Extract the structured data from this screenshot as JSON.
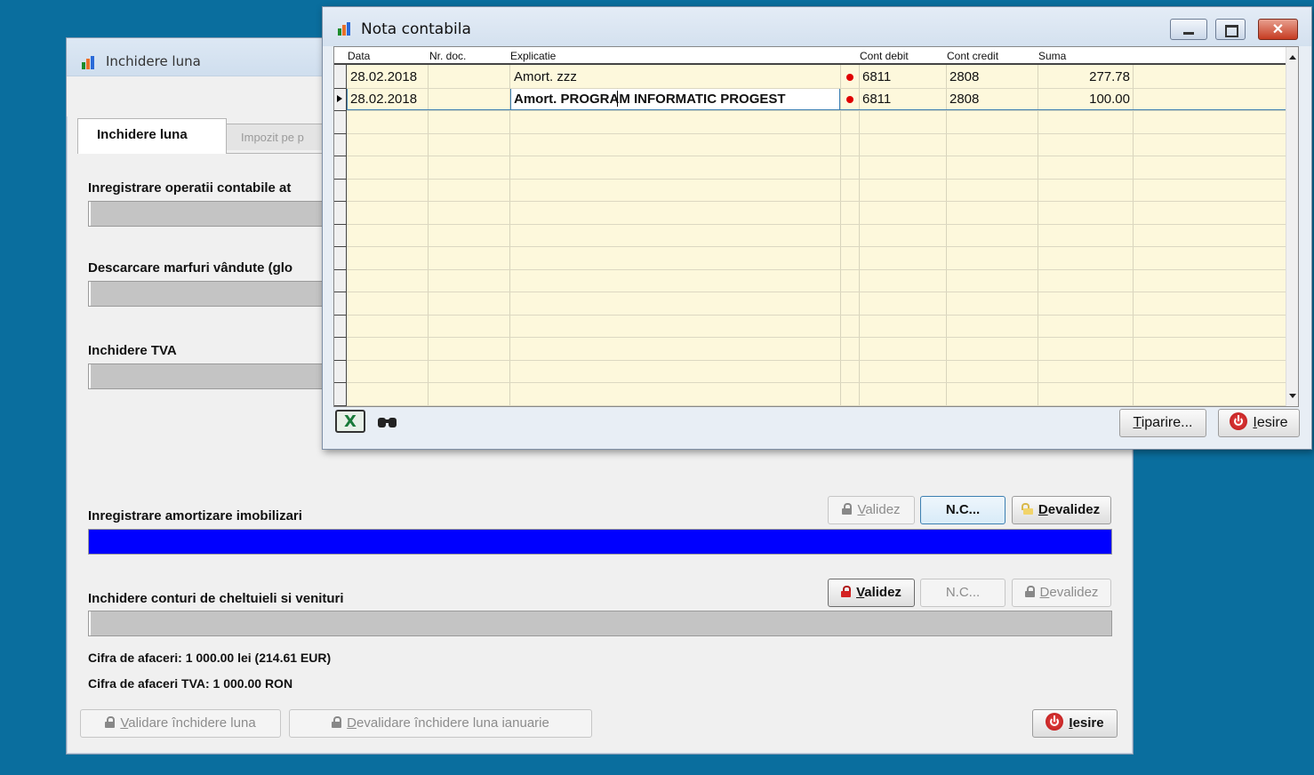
{
  "back_window": {
    "title": "Inchidere luna",
    "tabs": [
      "Inchidere luna",
      "Impozit pe p"
    ],
    "sections": {
      "operatii": "Inregistrare operatii contabile at",
      "descarcare": "Descarcare marfuri vândute (glo",
      "tva": "Inchidere TVA",
      "amortizare": "Inregistrare amortizare imobilizari",
      "cheltuieli": "Inchidere conturi de cheltuieli si venituri"
    },
    "amortizare_progress": 1.0,
    "buttons": {
      "validez_prefix": "V",
      "validez_rest": "alidez",
      "nc": "N.C...",
      "devalidez_prefix": "D",
      "devalidez_rest": "evalidez",
      "validare_prefix": "V",
      "validare_rest": "alidare închidere luna",
      "devalidare_prefix": "D",
      "devalidare_rest": "evalidare închidere luna ianuarie",
      "iesire_prefix": "I",
      "iesire_rest": "esire"
    },
    "cifra_afaceri": "Cifra de afaceri: 1 000.00 lei (214.61 EUR)",
    "cifra_afaceri_tva": "Cifra de afaceri TVA: 1 000.00 RON"
  },
  "front_window": {
    "title": "Nota contabila",
    "columns": [
      "Data",
      "Nr. doc.",
      "Explicatie",
      "Cont debit",
      "Cont credit",
      "Suma"
    ],
    "rows": [
      {
        "data": "28.02.2018",
        "nr_doc": "",
        "explicatie": "Amort. zzz",
        "cont_debit": "6811",
        "cont_credit": "2808",
        "suma": "277.78"
      },
      {
        "data": "28.02.2018",
        "nr_doc": "",
        "explicatie": "Amort. PROGRAM INFORMATIC PROGEST",
        "cont_debit": "6811",
        "cont_credit": "2808",
        "suma": "100.00"
      }
    ],
    "tiparire_prefix": "T",
    "tiparire_rest": "iparire...",
    "iesire_prefix": "I",
    "iesire_rest": "esire"
  },
  "icons": [
    "app-chart-icon",
    "minimize-icon",
    "maximize-icon",
    "close-icon",
    "excel-icon",
    "binoculars-icon",
    "lock-icon",
    "power-icon"
  ],
  "colors": {
    "desktop": "#0a6e9e",
    "progress_fill": "#0000ff",
    "grid_bg": "#fdf8dc",
    "selection": "#3c7fb1"
  }
}
